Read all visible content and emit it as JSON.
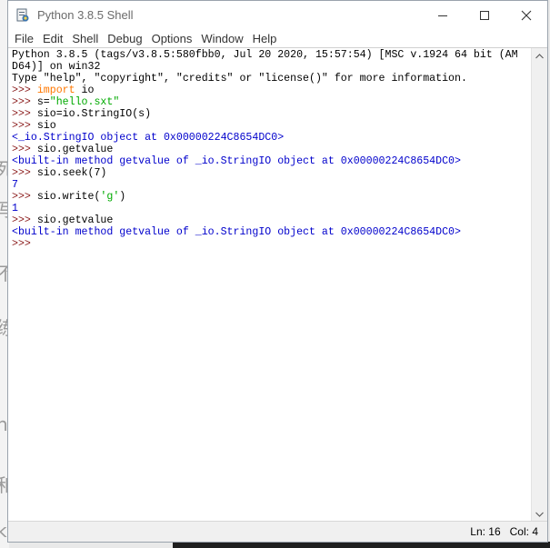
{
  "window": {
    "title": "Python 3.8.5 Shell"
  },
  "menu": [
    "File",
    "Edit",
    "Shell",
    "Debug",
    "Options",
    "Window",
    "Help"
  ],
  "shell": {
    "lines": [
      [
        {
          "t": "Python 3.8.5 (tags/v3.8.5:580fbb0, Jul 20 2020, 15:57:54) [MSC v.1924 64 bit (AM",
          "c": "plain"
        }
      ],
      [
        {
          "t": "D64)] on win32",
          "c": "plain"
        }
      ],
      [
        {
          "t": "Type \"help\", \"copyright\", \"credits\" or \"license()\" for more information.",
          "c": "plain"
        }
      ],
      [
        {
          "t": ">>> ",
          "c": "prompt"
        },
        {
          "t": "import",
          "c": "kw"
        },
        {
          "t": " io",
          "c": "plain"
        }
      ],
      [
        {
          "t": ">>> ",
          "c": "prompt"
        },
        {
          "t": "s=",
          "c": "plain"
        },
        {
          "t": "\"hello.sxt\"",
          "c": "str"
        }
      ],
      [
        {
          "t": ">>> ",
          "c": "prompt"
        },
        {
          "t": "sio=io.StringIO(s)",
          "c": "plain"
        }
      ],
      [
        {
          "t": ">>> ",
          "c": "prompt"
        },
        {
          "t": "sio",
          "c": "plain"
        }
      ],
      [
        {
          "t": "<_io.StringIO object at 0x00000224C8654DC0>",
          "c": "out"
        }
      ],
      [
        {
          "t": ">>> ",
          "c": "prompt"
        },
        {
          "t": "sio.getvalue",
          "c": "plain"
        }
      ],
      [
        {
          "t": "<built-in method getvalue of _io.StringIO object at 0x00000224C8654DC0>",
          "c": "out"
        }
      ],
      [
        {
          "t": ">>> ",
          "c": "prompt"
        },
        {
          "t": "sio.seek(7)",
          "c": "plain"
        }
      ],
      [
        {
          "t": "7",
          "c": "out"
        }
      ],
      [
        {
          "t": ">>> ",
          "c": "prompt"
        },
        {
          "t": "sio.write(",
          "c": "plain"
        },
        {
          "t": "'g'",
          "c": "str"
        },
        {
          "t": ")",
          "c": "plain"
        }
      ],
      [
        {
          "t": "1",
          "c": "out"
        }
      ],
      [
        {
          "t": ">>> ",
          "c": "prompt"
        },
        {
          "t": "sio.getvalue",
          "c": "plain"
        }
      ],
      [
        {
          "t": "<built-in method getvalue of _io.StringIO object at 0x00000224C8654DC0>",
          "c": "out"
        }
      ],
      [
        {
          "t": ">>> ",
          "c": "prompt"
        }
      ]
    ]
  },
  "status": {
    "line": "Ln: 16",
    "col": "Col: 4"
  },
  "icons": {
    "app": "python-idle-icon",
    "minimize": "minimize-icon",
    "maximize": "maximize-icon",
    "close": "close-icon"
  }
}
